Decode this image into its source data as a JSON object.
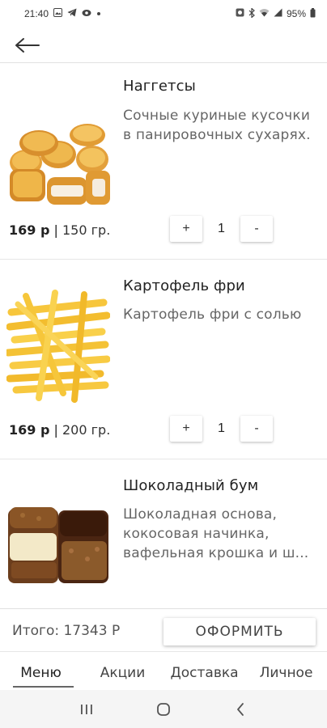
{
  "status_bar": {
    "time": "21:40",
    "left_icons": [
      "gallery-icon",
      "telegram-icon",
      "eye-icon",
      "dot-icon"
    ],
    "right_icons": [
      "alarm-icon",
      "bluetooth-icon",
      "wifi-icon",
      "signal-icon"
    ],
    "battery": "95%"
  },
  "header": {
    "back_icon": "arrow-left-icon"
  },
  "products": [
    {
      "name": "Наггетсы",
      "description": "Сочные куриные кусочки в панировочных сухарях.",
      "price": "169 р",
      "separator": "|",
      "weight": "150 гр.",
      "qty_plus": "+",
      "qty_value": "1",
      "qty_minus": "-"
    },
    {
      "name": "Картофель фри",
      "description": "Картофель фри с солью",
      "price": "169 р",
      "separator": "|",
      "weight": "200 гр.",
      "qty_plus": "+",
      "qty_value": "1",
      "qty_minus": "-"
    },
    {
      "name": "Шоколадный бум",
      "description": "Шоколадная основа, кокосовая начинка, вафельная крошка и ш...",
      "price": "",
      "weight": ""
    }
  ],
  "cart": {
    "total": "Итого: 17343 Р",
    "checkout_label": "ОФОРМИТЬ"
  },
  "nav": {
    "items": [
      "Меню",
      "Акции",
      "Доставка",
      "Личное"
    ],
    "active": "Меню"
  },
  "colors": {
    "divider": "#e6e6e6",
    "system_nav_bg": "#f5f5f5"
  }
}
